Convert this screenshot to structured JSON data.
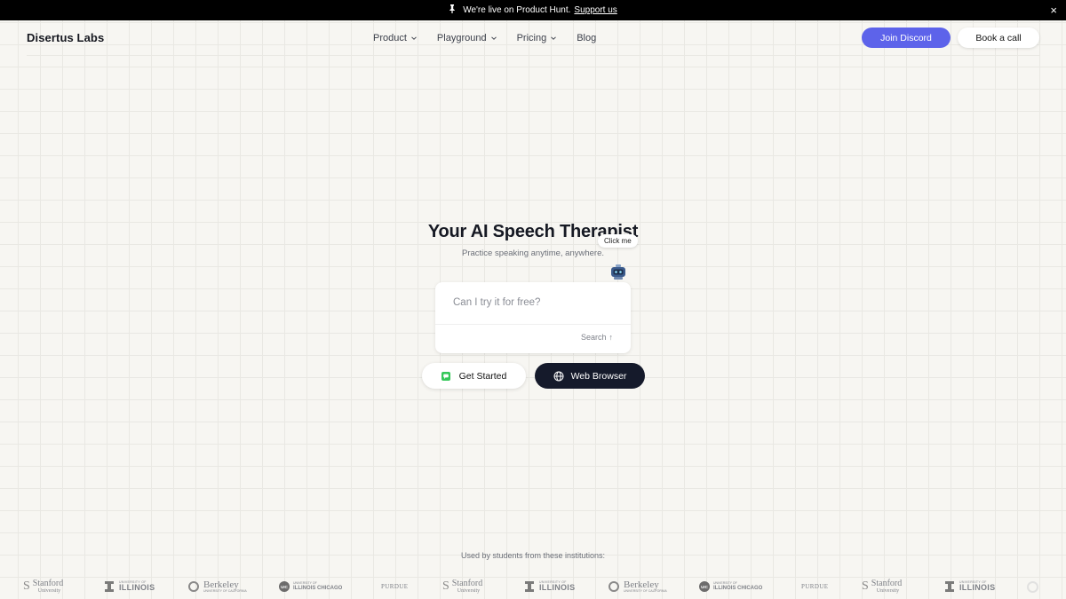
{
  "announcement": {
    "pin_icon": "pin-icon",
    "text": "We're live on Product Hunt.",
    "link_text": "Support us",
    "close_symbol": "×"
  },
  "nav": {
    "logo": "Disertus Labs",
    "menu": [
      {
        "label": "Product",
        "has_dropdown": true
      },
      {
        "label": "Playground",
        "has_dropdown": true
      },
      {
        "label": "Pricing",
        "has_dropdown": true
      },
      {
        "label": "Blog",
        "has_dropdown": false
      }
    ],
    "join_discord": "Join Discord",
    "book_call": "Book a call"
  },
  "hero": {
    "title": "Your AI Speech Therapist",
    "subtitle": "Practice speaking anytime, anywhere.",
    "click_me": "Click me",
    "search_placeholder": "Can I try it for free?",
    "search_label": "Search",
    "search_arrow": "↑",
    "get_started": "Get Started",
    "web_browser": "Web Browser"
  },
  "institutions": {
    "heading": "Used by students from these institutions:",
    "logos": [
      {
        "kind": "stanford",
        "name": "Stanford",
        "sub": "University"
      },
      {
        "kind": "illinois",
        "name": "ILLINOIS",
        "top": "UNIVERSITY OF"
      },
      {
        "kind": "berkeley",
        "name": "Berkeley",
        "sub": "UNIVERSITY OF CALIFORNIA"
      },
      {
        "kind": "uic",
        "name": "ILLINOIS CHICAGO",
        "top": "UNIVERSITY OF",
        "badge": "UIC"
      },
      {
        "kind": "purdue",
        "name": "PURDUE"
      }
    ]
  },
  "colors": {
    "accent": "#5d63ea",
    "dark_button": "#151a2b",
    "background": "#f7f6f2",
    "announcement_bg": "#000000"
  }
}
